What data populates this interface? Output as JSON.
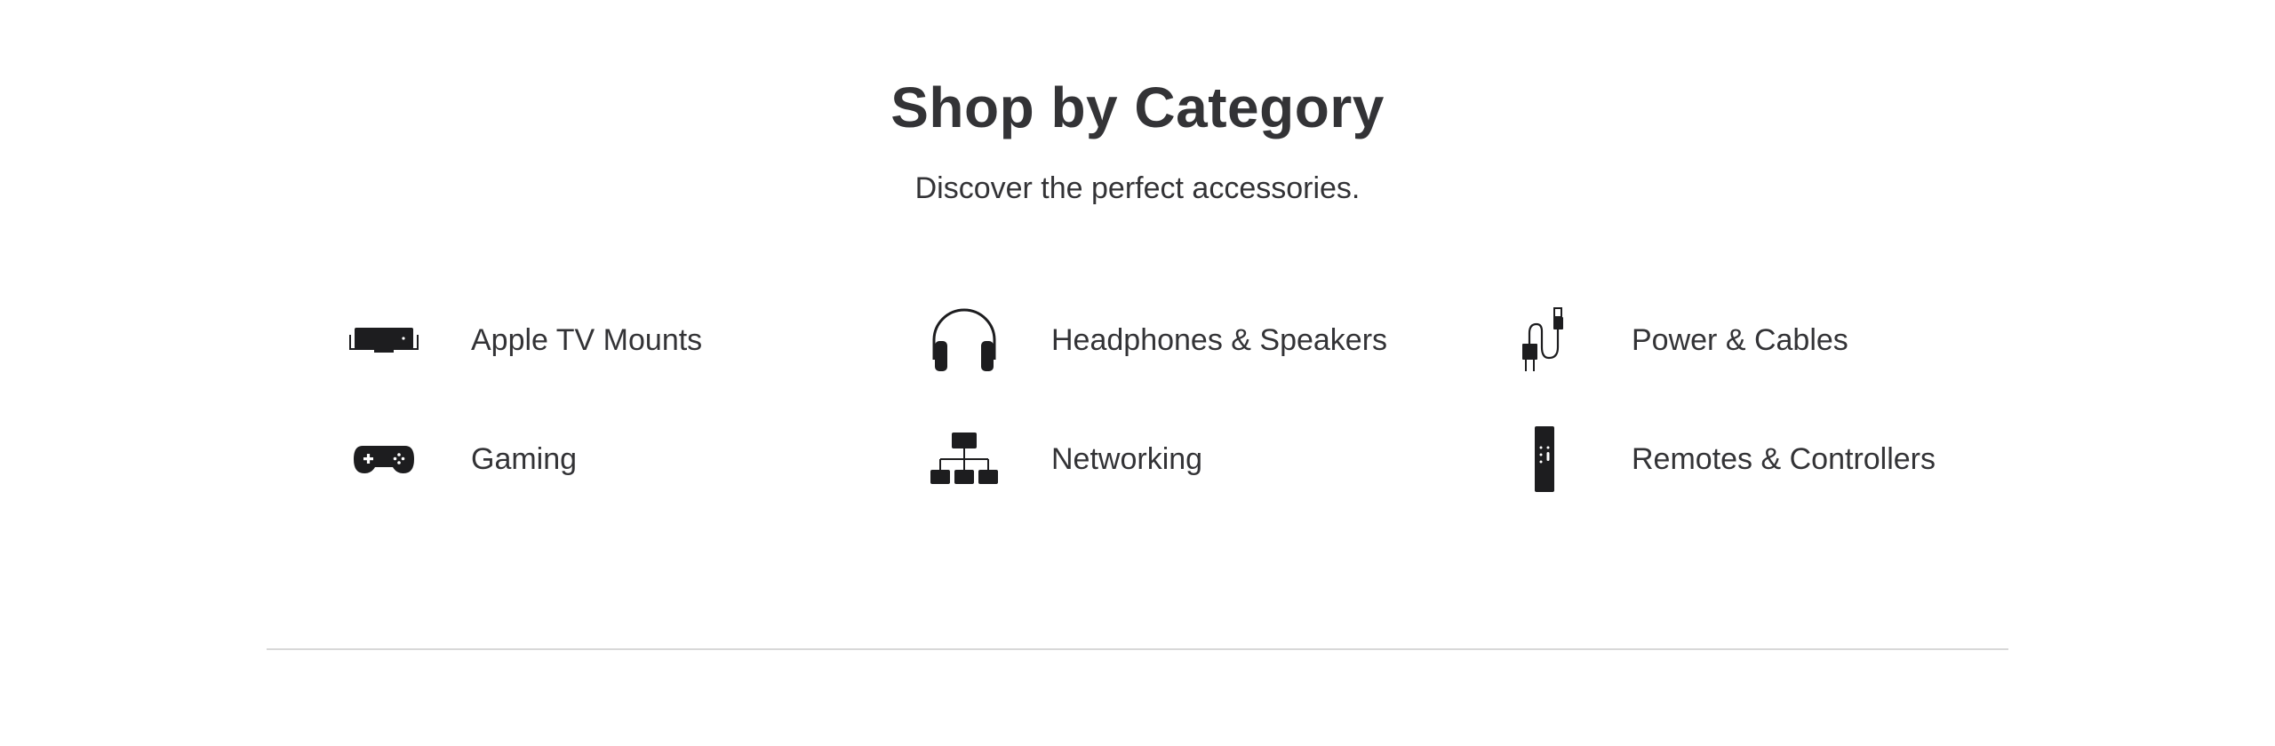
{
  "section": {
    "title": "Shop by Category",
    "subtitle": "Discover the perfect accessories."
  },
  "categories": [
    {
      "label": "Apple TV Mounts",
      "icon": "apple-tv-mount-icon"
    },
    {
      "label": "Headphones & Speakers",
      "icon": "headphones-icon"
    },
    {
      "label": "Power & Cables",
      "icon": "power-cable-icon"
    },
    {
      "label": "Gaming",
      "icon": "game-controller-icon"
    },
    {
      "label": "Networking",
      "icon": "network-icon"
    },
    {
      "label": "Remotes & Controllers",
      "icon": "remote-icon"
    }
  ],
  "colors": {
    "text": "#333336",
    "icon": "#1d1d1f",
    "divider": "#d8d8d8",
    "background": "#ffffff"
  }
}
